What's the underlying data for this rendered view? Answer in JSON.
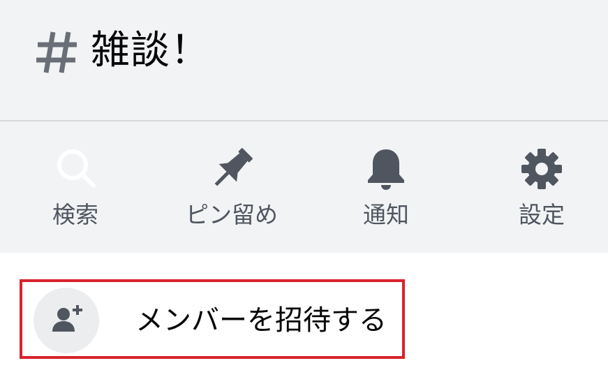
{
  "channel": {
    "name": "雑談！"
  },
  "actions": [
    {
      "label": "検索",
      "icon": "search-icon"
    },
    {
      "label": "ピン留め",
      "icon": "pin-icon"
    },
    {
      "label": "通知",
      "icon": "bell-icon"
    },
    {
      "label": "設定",
      "icon": "gear-icon"
    }
  ],
  "invite": {
    "label": "メンバーを招待する",
    "icon": "add-user-icon"
  },
  "colors": {
    "header_bg": "#f2f3f5",
    "icon": "#4f5660",
    "highlight_border": "#d8232a"
  }
}
